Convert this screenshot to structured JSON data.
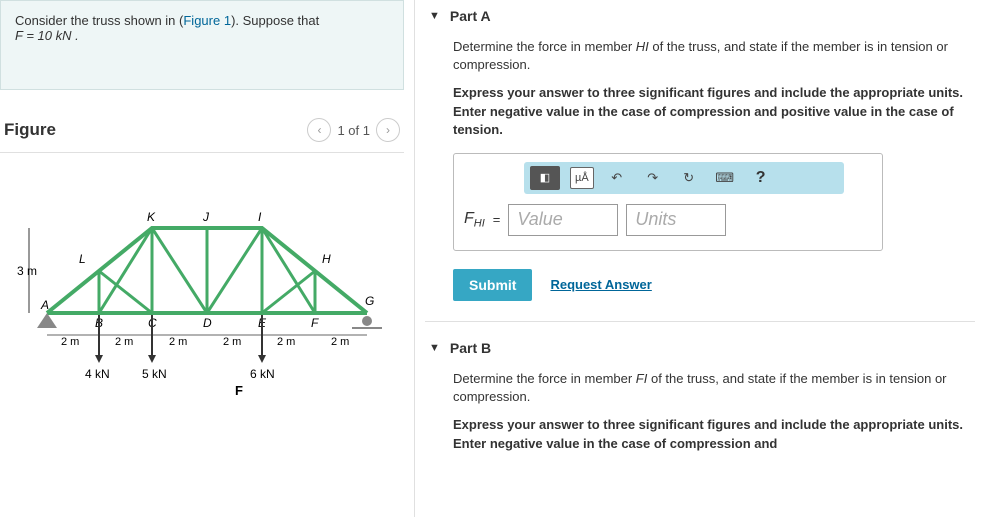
{
  "left": {
    "problem_line1": "Consider the truss shown in (",
    "figure_link": "Figure 1",
    "problem_line2": "). Suppose that",
    "problem_eq": "F = 10  kN .",
    "figure_label": "Figure",
    "pager_text": "1 of 1",
    "truss": {
      "height_label": "3 m",
      "nodes_top": [
        "K",
        "J",
        "I"
      ],
      "nodes_mid": [
        "L",
        "H"
      ],
      "nodes_bottom": [
        "A",
        "B",
        "C",
        "D",
        "E",
        "F",
        "G"
      ],
      "spans": [
        "2 m",
        "2 m",
        "2 m",
        "2 m",
        "2 m",
        "2 m"
      ],
      "loads": [
        "4 kN",
        "5 kN",
        "",
        "6 kN"
      ],
      "force_label": "F"
    }
  },
  "right": {
    "partA": {
      "title": "Part A",
      "prompt_pre": "Determine the force in member ",
      "member": "HI",
      "prompt_post": " of the truss, and state if the member is in tension or compression.",
      "instructions": "Express your answer to three significant figures and include the appropriate units. Enter negative value in the case of compression and positive value in the case of tension.",
      "var_label": "F",
      "var_sub": "HI",
      "eq": "=",
      "value_ph": "Value",
      "units_ph": "Units",
      "submit": "Submit",
      "request": "Request Answer",
      "toolbar_units": "µÅ",
      "toolbar_undo": "↶",
      "toolbar_redo": "↷",
      "toolbar_reset": "↻",
      "toolbar_key": "⌨",
      "toolbar_help": "?"
    },
    "partB": {
      "title": "Part B",
      "prompt_pre": "Determine the force in member ",
      "member": "FI",
      "prompt_post": " of the truss, and state if the member is in tension or compression.",
      "instructions": "Express your answer to three significant figures and include the appropriate units. Enter negative value in the case of compression and"
    }
  }
}
